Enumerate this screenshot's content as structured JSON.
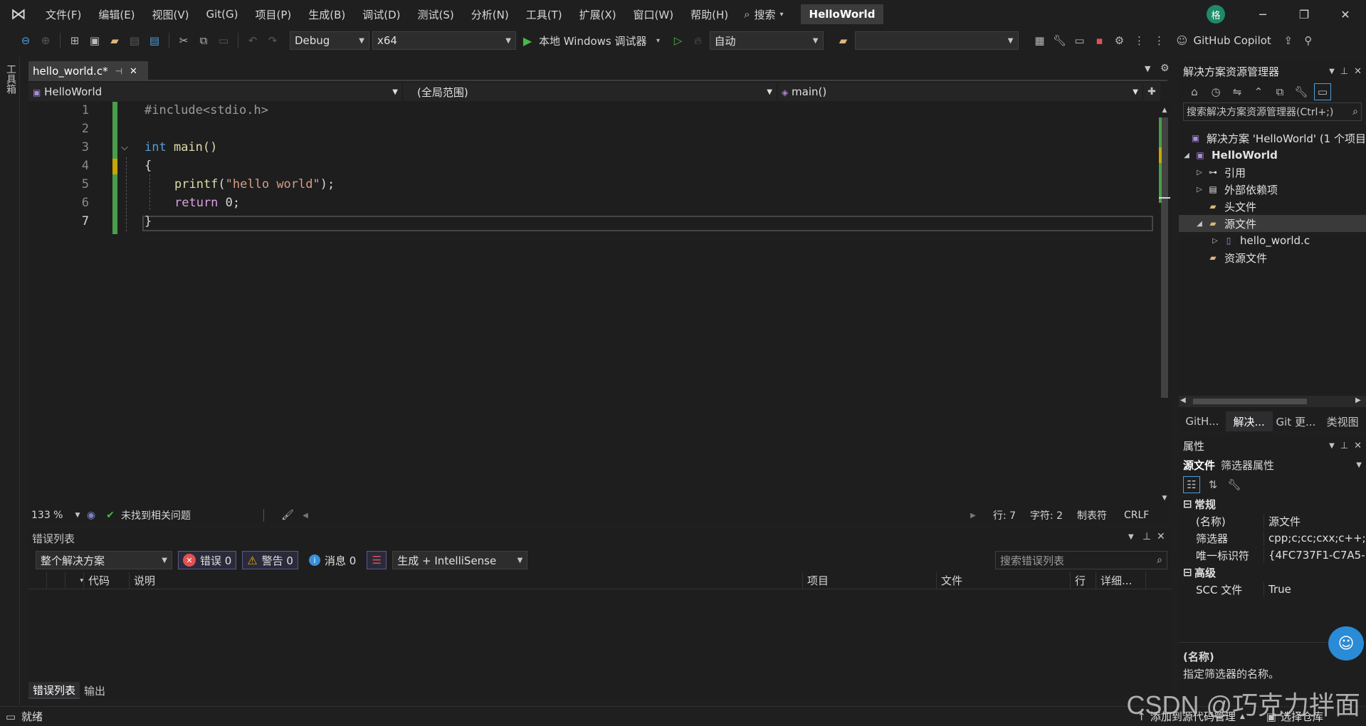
{
  "title_bar": {
    "menus": [
      "文件(F)",
      "编辑(E)",
      "视图(V)",
      "Git(G)",
      "项目(P)",
      "生成(B)",
      "调试(D)",
      "测试(S)",
      "分析(N)",
      "工具(T)",
      "扩展(X)",
      "窗口(W)",
      "帮助(H)"
    ],
    "search_label": "搜索",
    "solution_title": "HelloWorld",
    "avatar_initial": "格"
  },
  "toolbar": {
    "config": "Debug",
    "platform": "x64",
    "debugger": "本地 Windows 调试器",
    "auto": "自动",
    "copilot": "GitHub Copilot"
  },
  "toolstrip_label": "工具箱",
  "editor": {
    "tab_name": "hello_world.c*",
    "nav_project": "HelloWorld",
    "nav_scope": "(全局范围)",
    "nav_function": "main()",
    "lines": [
      "1",
      "2",
      "3",
      "4",
      "5",
      "6",
      "7"
    ],
    "code": {
      "include": "#include<stdio.h>",
      "int_kw": "int",
      "main_sig": " main()",
      "open_brace": "{",
      "printf_fn": "printf",
      "printf_open": "(",
      "printf_str": "\"hello world\"",
      "printf_close": ");",
      "return_kw": "return",
      "return_val": " 0;",
      "close_brace": "}"
    },
    "zoom": "133 %",
    "issues": "未找到相关问题",
    "line_pos": "行: 7",
    "char_pos": "字符: 2",
    "tab_mode": "制表符",
    "eol": "CRLF"
  },
  "error_list": {
    "title": "错误列表",
    "scope": "整个解决方案",
    "errors": "错误 0",
    "warnings": "警告 0",
    "messages": "消息 0",
    "source": "生成 + IntelliSense",
    "search_placeholder": "搜索错误列表",
    "columns": [
      "代码",
      "说明",
      "项目",
      "文件",
      "行",
      "详细..."
    ],
    "tabs": [
      "错误列表",
      "输出"
    ]
  },
  "solution_explorer": {
    "title": "解决方案资源管理器",
    "search_placeholder": "搜索解决方案资源管理器(Ctrl+;)",
    "solution_node": "解决方案 'HelloWorld' (1 个项目",
    "project_node": "HelloWorld",
    "nodes": [
      "引用",
      "外部依赖项",
      "头文件",
      "源文件",
      "hello_world.c",
      "资源文件"
    ],
    "tabs": [
      "GitH...",
      "解决...",
      "Git 更...",
      "类视图"
    ]
  },
  "properties": {
    "title": "属性",
    "object_name": "源文件",
    "object_type": "筛选器属性",
    "cat_general": "常规",
    "rows": [
      {
        "key": "(名称)",
        "value": "源文件"
      },
      {
        "key": "筛选器",
        "value": "cpp;c;cc;cxx;c++;"
      },
      {
        "key": "唯一标识符",
        "value": "{4FC737F1-C7A5-"
      }
    ],
    "cat_advanced": "高级",
    "scc_key": "SCC 文件",
    "scc_value": "True",
    "desc_title": "(名称)",
    "desc_text": "指定筛选器的名称。"
  },
  "status_bar": {
    "ready": "就绪",
    "add_source": "添加到源代码管理",
    "select_repo": "选择仓库"
  },
  "watermark": "CSDN @巧克力拌面",
  "colors": {
    "accent": "#45b849",
    "changebar": "#4a9d4a",
    "error": "#e05252",
    "warning": "#e0b000"
  }
}
